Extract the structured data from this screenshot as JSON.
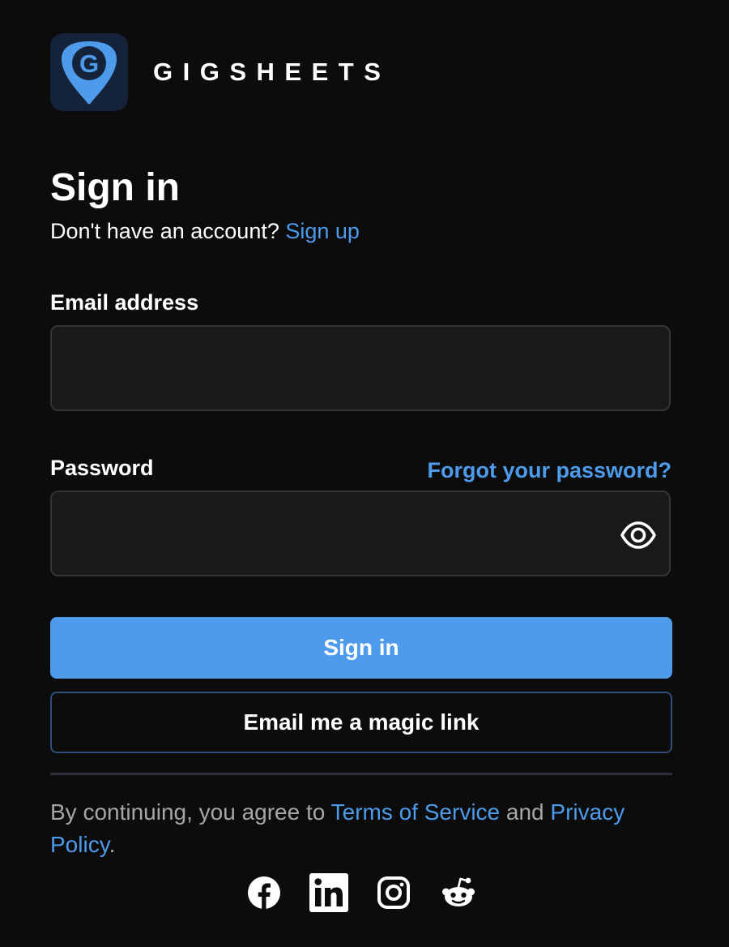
{
  "brand": {
    "name": "GIGSHEETS",
    "logo_letter": "G",
    "accent": "#4d9bea"
  },
  "heading": "Sign in",
  "signup_prompt": {
    "text": "Don't have an account?",
    "link": "Sign up"
  },
  "email": {
    "label": "Email address",
    "value": "",
    "placeholder": ""
  },
  "password": {
    "label": "Password",
    "value": "",
    "placeholder": "",
    "forgot_link": "Forgot your password?",
    "toggle_icon": "eye-icon"
  },
  "buttons": {
    "sign_in": "Sign in",
    "magic_link": "Email me a magic link"
  },
  "legal": {
    "prefix": "By continuing, you agree to",
    "terms": "Terms of Service",
    "and": "and",
    "privacy": "Privacy Policy",
    "suffix": "."
  },
  "social": [
    {
      "icon": "facebook-icon"
    },
    {
      "icon": "linkedin-icon"
    },
    {
      "icon": "instagram-icon"
    },
    {
      "icon": "reddit-icon"
    }
  ]
}
